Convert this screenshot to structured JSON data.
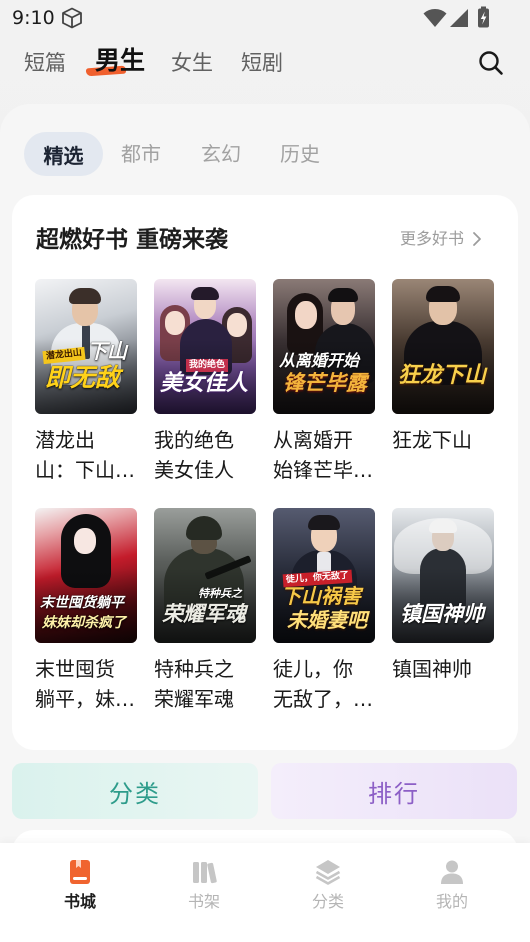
{
  "status_bar": {
    "time": "9:10",
    "icons": [
      "cube-icon",
      "wifi-icon",
      "signal-icon",
      "battery-charging-icon"
    ]
  },
  "top_tabs": {
    "items": [
      {
        "label": "短篇",
        "selected": false
      },
      {
        "label": "男生",
        "selected": true
      },
      {
        "label": "女生",
        "selected": false
      },
      {
        "label": "短剧",
        "selected": false
      }
    ],
    "search_icon": "search-icon"
  },
  "sub_tabs": {
    "items": [
      {
        "label": "精选",
        "selected": true
      },
      {
        "label": "都市",
        "selected": false
      },
      {
        "label": "玄幻",
        "selected": false
      },
      {
        "label": "历史",
        "selected": false
      }
    ]
  },
  "featured": {
    "title": "超燃好书 重磅来袭",
    "more_label": "更多好书",
    "more_icon": "chevron-right-icon",
    "books": [
      {
        "title_lines": [
          "潜龙出",
          "山：下山…"
        ],
        "cover": {
          "tag": "潜龙出山",
          "lines": [
            "下山",
            "即无敌"
          ]
        }
      },
      {
        "title_lines": [
          "我的绝色",
          "美女佳人"
        ],
        "cover": {
          "tag": "我的绝色",
          "lines": [
            "美女佳人"
          ]
        }
      },
      {
        "title_lines": [
          "从离婚开",
          "始锋芒毕…"
        ],
        "cover": {
          "lines": [
            "从离婚开始",
            "锋芒毕露"
          ]
        }
      },
      {
        "title_lines": [
          "狂龙下山"
        ],
        "cover": {
          "lines": [
            "狂龙下山"
          ]
        }
      },
      {
        "title_lines": [
          "末世囤货",
          "躺平，妹…"
        ],
        "cover": {
          "lines": [
            "末世囤货躺平",
            "妹妹却杀疯了"
          ]
        }
      },
      {
        "title_lines": [
          "特种兵之",
          "荣耀军魂"
        ],
        "cover": {
          "tag": "特种兵之",
          "lines": [
            "荣耀军魂"
          ]
        }
      },
      {
        "title_lines": [
          "徒儿，你",
          "无敌了，…"
        ],
        "cover": {
          "tag": "徒儿，你无敌了",
          "lines": [
            "下山祸害",
            "未婚妻吧"
          ]
        }
      },
      {
        "title_lines": [
          "镇国神帅"
        ],
        "cover": {
          "lines": [
            "镇国神帅"
          ]
        }
      }
    ]
  },
  "shortcuts": {
    "category_label": "分类",
    "ranking_label": "排行"
  },
  "bottom_nav": {
    "items": [
      {
        "label": "书城",
        "icon": "book-icon",
        "selected": true
      },
      {
        "label": "书架",
        "icon": "bookshelf-icon",
        "selected": false
      },
      {
        "label": "分类",
        "icon": "layers-icon",
        "selected": false
      },
      {
        "label": "我的",
        "icon": "user-icon",
        "selected": false
      }
    ]
  },
  "colors": {
    "accent": "#f0642f",
    "page_bg": "#efefef",
    "panel_bg": "#f6f6f6",
    "card_bg": "#ffffff",
    "selected_pill_bg": "#e3e8f0",
    "category_text": "#2e9c8b",
    "ranking_text": "#8c5fc6",
    "muted_text": "#a2a2a2"
  }
}
